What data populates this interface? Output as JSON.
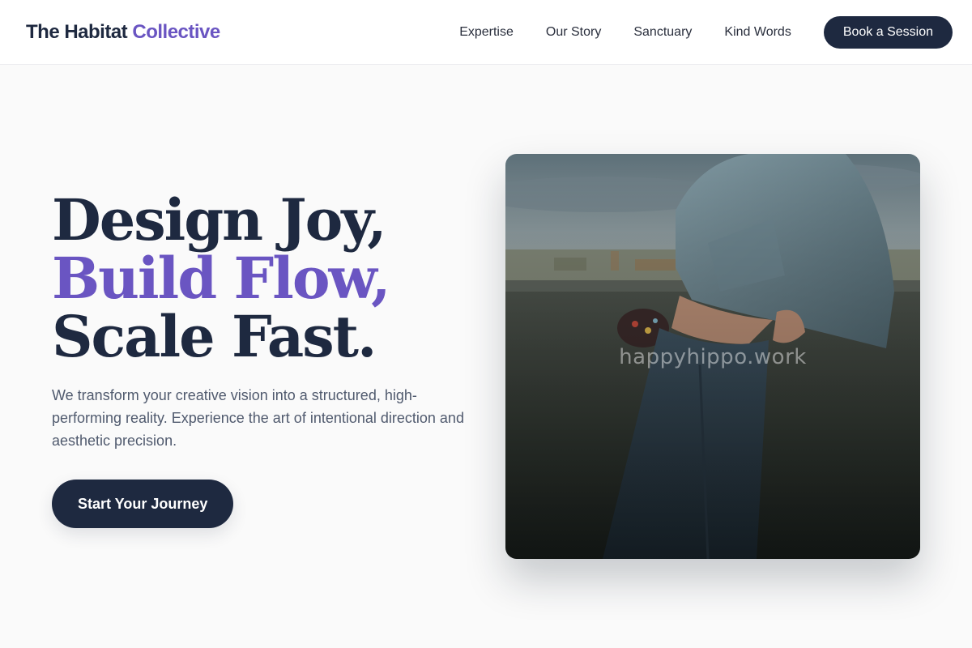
{
  "brand": {
    "name": "The Habitat",
    "accent": "Collective"
  },
  "nav": {
    "links": [
      "Expertise",
      "Our Story",
      "Sanctuary",
      "Kind Words"
    ],
    "cta": "Book a Session"
  },
  "hero": {
    "headline": {
      "line1": "Design Joy,",
      "line2": "Build Flow,",
      "line3": "Scale Fast."
    },
    "subtitle": "We transform your creative vision into a structured, high-performing reality. Experience the art of intentional direction and aesthetic precision.",
    "cta": "Start Your Journey",
    "image": {
      "watermark": "happyhippo.work"
    }
  },
  "colors": {
    "primary": "#1e2940",
    "accent": "#6a55c2",
    "background": "#fafafa",
    "text_muted": "#505a6e"
  }
}
